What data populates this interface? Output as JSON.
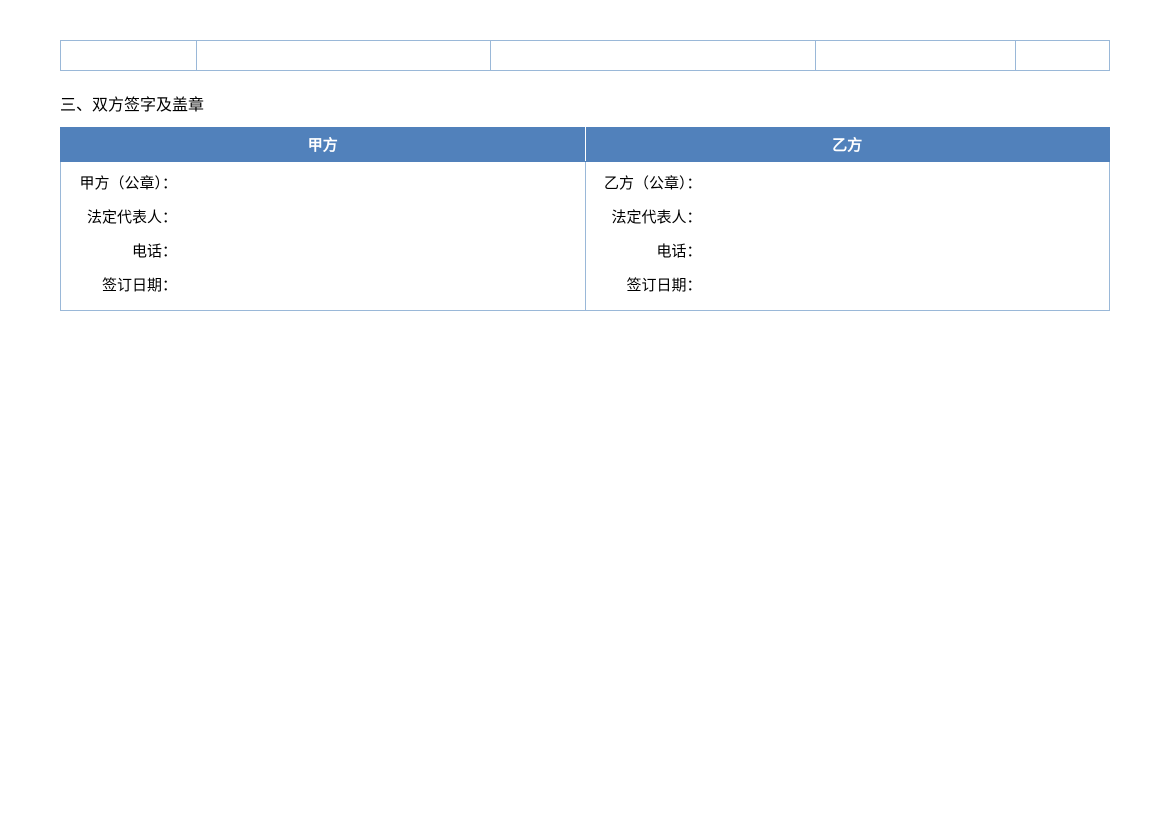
{
  "sectionTitle": "三、双方签字及盖章",
  "headers": {
    "partyA": "甲方",
    "partyB": "乙方"
  },
  "partyA": {
    "seal": {
      "label": "甲方（公章）：",
      "value": ""
    },
    "rep": {
      "label": "法定代表人：",
      "value": ""
    },
    "phone": {
      "label": "电话：",
      "value": ""
    },
    "date": {
      "label": "签订日期：",
      "value": ""
    }
  },
  "partyB": {
    "seal": {
      "label": "乙方（公章）：",
      "value": ""
    },
    "rep": {
      "label": "法定代表人：",
      "value": ""
    },
    "phone": {
      "label": "电话：",
      "value": ""
    },
    "date": {
      "label": "签订日期：",
      "value": ""
    }
  }
}
